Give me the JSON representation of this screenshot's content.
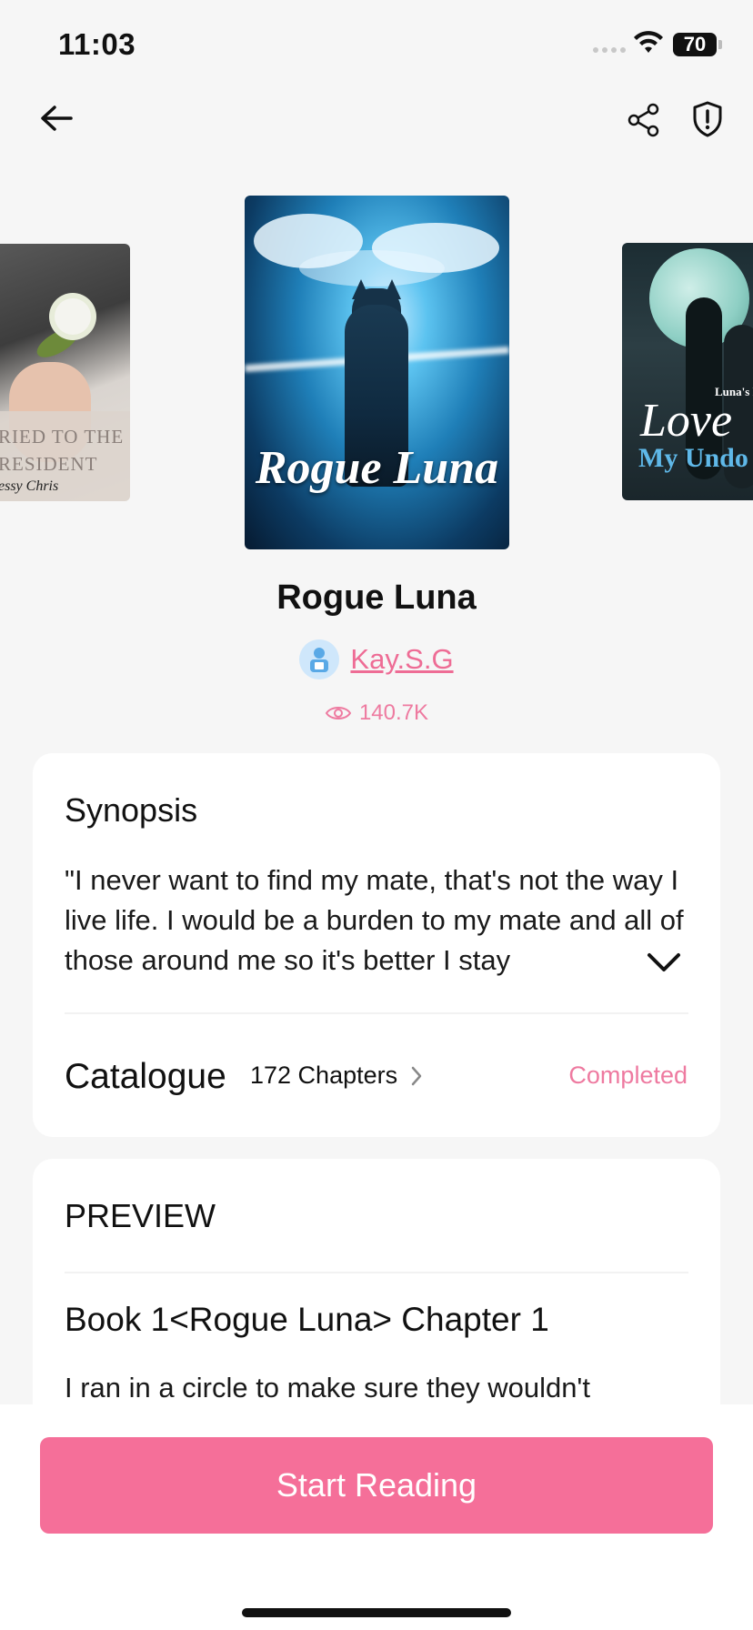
{
  "status_bar": {
    "time": "11:03",
    "battery": "70"
  },
  "header": {
    "back_icon": "arrow-left-icon",
    "share_icon": "share-icon",
    "report_icon": "shield-alert-icon"
  },
  "carousel": {
    "left": {
      "line1": "RIED TO THE",
      "line2": "RESIDENT",
      "author": "essy Chris"
    },
    "main": {
      "cover_title": "Rogue Luna"
    },
    "right": {
      "subtitle": "Luna's Regret",
      "line1": "Love",
      "line2": "My Undo"
    }
  },
  "book": {
    "title": "Rogue Luna",
    "author": "Kay.S.G",
    "views": "140.7K"
  },
  "synopsis": {
    "heading": "Synopsis",
    "text": "\"I never want to find my mate, that's not the way I live life. I would be a burden to my mate and all of those around me so it's better I stay"
  },
  "catalogue": {
    "heading": "Catalogue",
    "count": "172 Chapters",
    "status": "Completed"
  },
  "preview": {
    "heading": "PREVIEW",
    "chapter_title": "Book 1<Rogue Luna> Chapter 1",
    "chapter_text": "I ran in a circle to make sure they wouldn't"
  },
  "action": {
    "start_label": "Start Reading"
  },
  "colors": {
    "accent": "#f56f99",
    "accent_text": "#ee6c95",
    "background": "#f6f6f6"
  }
}
